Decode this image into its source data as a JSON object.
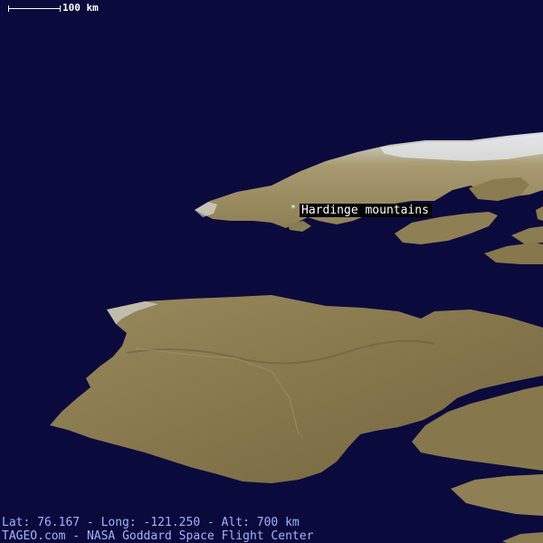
{
  "map": {
    "scale_label": "100 km",
    "place_name": "Hardinge mountains",
    "coordinates_line": "Lat: 76.167 - Long: -121.250 - Alt: 700 km",
    "credit": {
      "site": "TAGEO.com",
      "separator": " - ",
      "source": "NASA Goddard Space Flight Center"
    },
    "colors": {
      "ocean": "#0b0a3c",
      "land": "#8a7a4f",
      "ice": "#e8ecf2",
      "label_bg": "#000000",
      "footer_text": "#9fb4ff"
    }
  }
}
